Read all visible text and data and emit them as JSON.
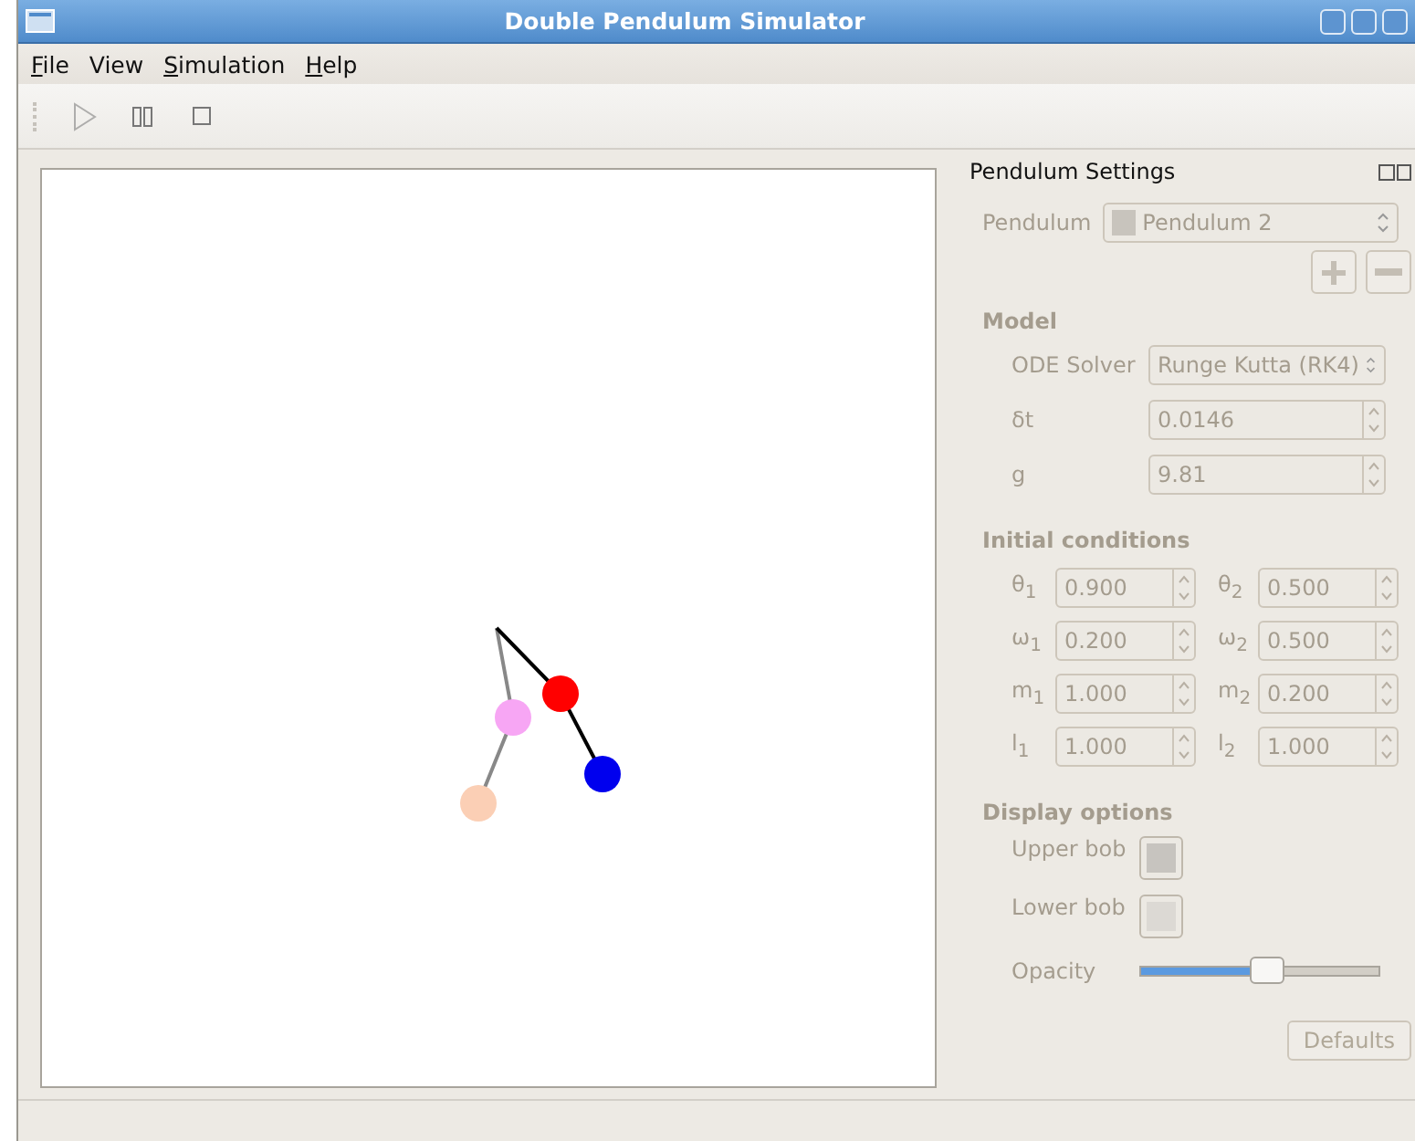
{
  "window": {
    "title": "Double Pendulum Simulator"
  },
  "menu": [
    {
      "mnemonic": "F",
      "rest": "ile"
    },
    {
      "rest": "View"
    },
    {
      "mnemonic": "S",
      "rest": "imulation"
    },
    {
      "mnemonic": "H",
      "rest": "elp"
    }
  ],
  "toolbar": [
    {
      "kind": "play",
      "disabled": true
    },
    {
      "kind": "pause",
      "disabled": false
    },
    {
      "kind": "stop",
      "disabled": false
    }
  ],
  "settings": {
    "title": "Pendulum Settings",
    "disabled": true,
    "pendulum": {
      "label": "Pendulum",
      "value": "Pendulum 2"
    },
    "model": {
      "heading": "Model",
      "solver_label": "ODE Solver",
      "solver": "Runge Kutta (RK4)",
      "fields": [
        {
          "label": "δt",
          "value": "0.0146"
        },
        {
          "label": "g",
          "value": "9.81"
        }
      ]
    },
    "initial": {
      "heading": "Initial conditions",
      "fields": [
        {
          "label": "θ$_{1}$",
          "value": "0.900"
        },
        {
          "label": "θ$_{2}$",
          "value": "0.500"
        },
        {
          "label": "ω$_{1}$",
          "value": "0.200"
        },
        {
          "label": "ω$_{2}$",
          "value": "0.500"
        },
        {
          "label": "m$_{1}$",
          "value": "1.000"
        },
        {
          "label": "m$_{2}$",
          "value": "0.200"
        },
        {
          "label": "l$_{1}$",
          "value": "1.000"
        },
        {
          "label": "l$_{2}$",
          "value": "1.000"
        }
      ]
    },
    "display": {
      "heading": "Display options",
      "upper_label": "Upper bob",
      "lower_label": "Lower bob",
      "opacity_label": "Opacity",
      "opacity": {
        "level": 0.53
      }
    },
    "defaults_button": "Defaults"
  }
}
